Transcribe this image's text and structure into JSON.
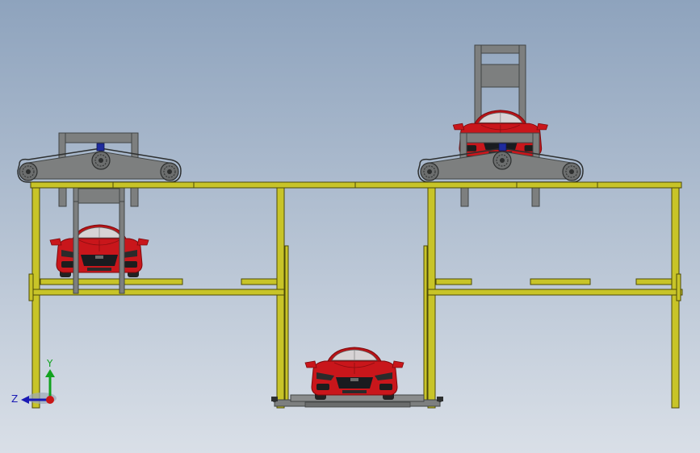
{
  "triad": {
    "y_label": "Y",
    "z_label": "Z"
  },
  "colors": {
    "background_top": "#8ea3bd",
    "background_bottom": "#d9dfe7",
    "frame": "#c8c428",
    "frame_edge": "#4d4a08",
    "gray": "#7d7f7f",
    "gray_dark": "#414444",
    "car_red": "#c9161b",
    "car_red_dark": "#7d0a0c",
    "grille": "#191b1f",
    "glass": "#d7d3d5",
    "axis_y": "#12a21f",
    "axis_z": "#1a1ab4",
    "axis_x": "#c91616"
  }
}
